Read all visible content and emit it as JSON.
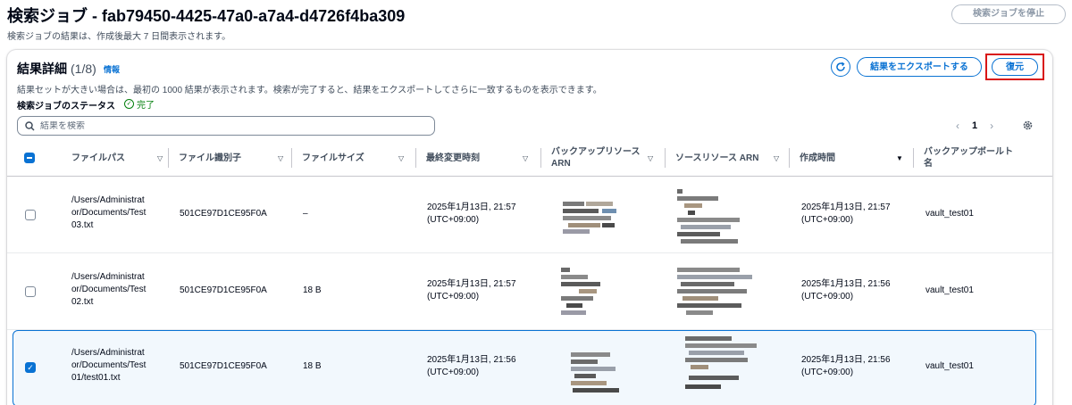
{
  "header": {
    "title": "検索ジョブ - fab79450-4425-47a0-a7a4-d4726f4ba309",
    "subtitle": "検索ジョブの結果は、作成後最大 7 日間表示されます。",
    "stop_button": "検索ジョブを停止"
  },
  "panel": {
    "title": "結果詳細",
    "count": "(1/8)",
    "info_link": "情報",
    "description": "結果セットが大きい場合は、最初の 1000 結果が表示されます。検索が完了すると、結果をエクスポートしてさらに一致するものを表示できます。",
    "status_label": "検索ジョブのステータス",
    "status_value": "完了",
    "export_button": "結果をエクスポートする",
    "restore_button": "復元",
    "search_placeholder": "結果を検索"
  },
  "pagination": {
    "current_page": "1"
  },
  "table": {
    "columns": [
      "ファイルパス",
      "ファイル識別子",
      "ファイルサイズ",
      "最終変更時刻",
      "バックアップリソース ARN",
      "ソースリソース ARN",
      "作成時間",
      "バックアップボールト名"
    ],
    "rows": [
      {
        "selected": false,
        "file_path": [
          "/Users/Administrat",
          "or/Documents/Test",
          "03.txt"
        ],
        "file_id": "501CE97D1CE95F0A",
        "size": "–",
        "modified": [
          "2025年1月13日, 21:57",
          "(UTC+09:00)"
        ],
        "created": [
          "2025年1月13日, 21:57",
          "(UTC+09:00)"
        ],
        "vault": "vault_test01"
      },
      {
        "selected": false,
        "file_path": [
          "/Users/Administrat",
          "or/Documents/Test",
          "02.txt"
        ],
        "file_id": "501CE97D1CE95F0A",
        "size": "18 B",
        "modified": [
          "2025年1月13日, 21:57",
          "(UTC+09:00)"
        ],
        "created": [
          "2025年1月13日, 21:56",
          "(UTC+09:00)"
        ],
        "vault": "vault_test01"
      },
      {
        "selected": true,
        "file_path": [
          "/Users/Administrat",
          "or/Documents/Test",
          "01/test01.txt"
        ],
        "file_id": "501CE97D1CE95F0A",
        "size": "18 B",
        "modified": [
          "2025年1月13日, 21:56",
          "(UTC+09:00)"
        ],
        "created": [
          "2025年1月13日, 21:56",
          "(UTC+09:00)"
        ],
        "vault": "vault_test01"
      }
    ]
  },
  "colors": {
    "accent": "#0972d3",
    "success": "#037f0c",
    "highlight_border": "#d91515",
    "selected_row_bg": "#f2f8fd"
  }
}
